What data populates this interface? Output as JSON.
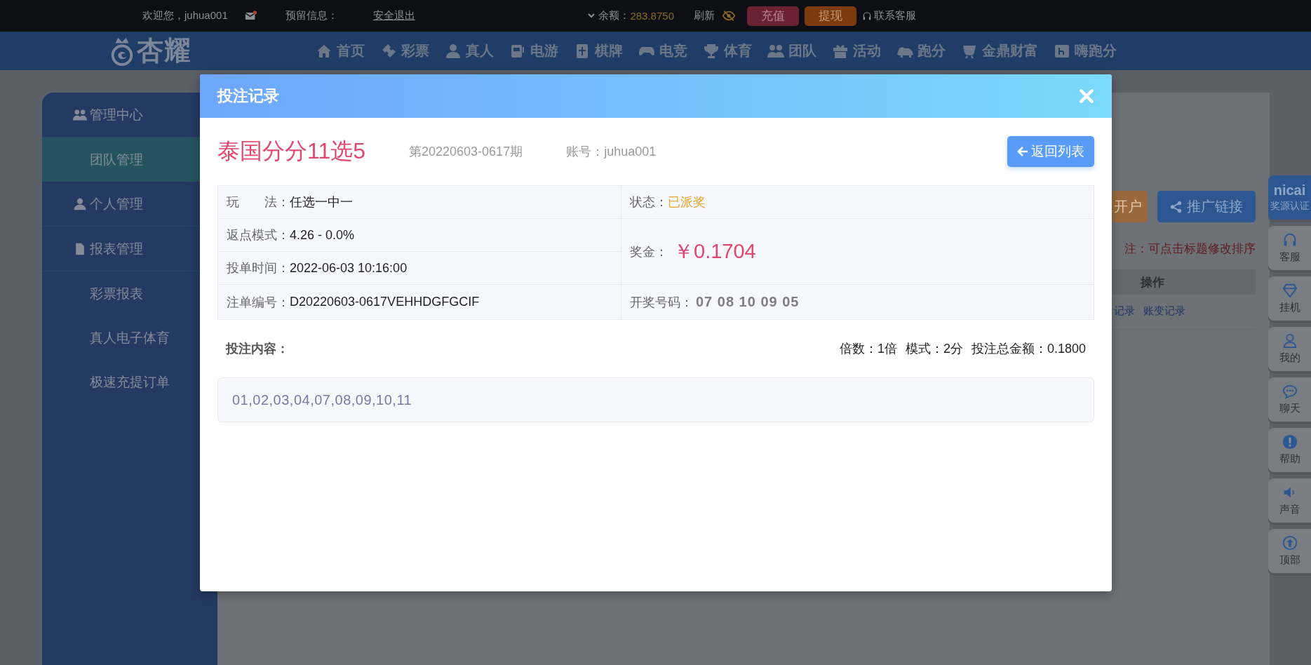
{
  "top_bar": {
    "welcome": "欢迎您，juhua001",
    "reserved_label": "预留信息：",
    "logout": "安全退出",
    "balance_label": "余额：",
    "balance": "283.8750",
    "refresh": "刷新",
    "deposit": "充值",
    "withdraw": "提现",
    "support": "联系客服"
  },
  "nav": {
    "logo": "杏耀",
    "items": [
      {
        "label": "首页",
        "kind": "home"
      },
      {
        "label": "彩票",
        "kind": "ticket"
      },
      {
        "label": "真人",
        "kind": "person"
      },
      {
        "label": "电游",
        "kind": "slot"
      },
      {
        "label": "棋牌",
        "kind": "card"
      },
      {
        "label": "电竞",
        "kind": "gamepad"
      },
      {
        "label": "体育",
        "kind": "trophy"
      },
      {
        "label": "团队",
        "kind": "team"
      },
      {
        "label": "活动",
        "kind": "gift"
      },
      {
        "label": "跑分",
        "kind": "rhino"
      },
      {
        "label": "金鼎财富",
        "kind": "cup"
      },
      {
        "label": "嗨跑分",
        "kind": "h"
      }
    ]
  },
  "sidebar": {
    "groups": [
      {
        "label": "管理中心",
        "kind": "team",
        "children": [
          {
            "label": "团队管理",
            "selected": true
          }
        ]
      },
      {
        "label": "个人管理",
        "kind": "person"
      },
      {
        "label": "报表管理",
        "kind": "doc",
        "children": [
          {
            "label": "彩票报表",
            "selected": false
          },
          {
            "label": "真人电子体育",
            "selected": false
          },
          {
            "label": "极速充提订单",
            "selected": false
          }
        ]
      }
    ]
  },
  "content": {
    "buttons": [
      {
        "label": "开户",
        "kind": "orange"
      },
      {
        "label": "推广链接",
        "kind": "share"
      }
    ],
    "note": "注：可点击标题修改排序",
    "table_header": "操作",
    "links": [
      "记录",
      "账变记录"
    ]
  },
  "side_tabs": [
    {
      "label": "奖源认证",
      "kind": "brand",
      "brand": "nicai"
    },
    {
      "label": "客服",
      "kind": "headset"
    },
    {
      "label": "挂机",
      "kind": "diamond"
    },
    {
      "label": "我的",
      "kind": "user"
    },
    {
      "label": "聊天",
      "kind": "chat"
    },
    {
      "label": "帮助",
      "kind": "help"
    },
    {
      "label": "声音",
      "kind": "sound"
    },
    {
      "label": "顶部",
      "kind": "top"
    }
  ],
  "modal": {
    "title": "投注记录",
    "lottery": "泰国分分11选5",
    "issue": "第20220603-0617期",
    "account": "账号：juhua001",
    "back_button": "返回列表",
    "details": {
      "play": {
        "label": "玩　　法：",
        "value": "任选一中一"
      },
      "status": {
        "label": "状态：",
        "value": "已派奖"
      },
      "rebate": {
        "label": "返点模式：",
        "value": "4.26 - 0.0%"
      },
      "prize": {
        "label": "奖金：",
        "value": "￥0.1704"
      },
      "time": {
        "label": "投单时间：",
        "value": "2022-06-03 10:16:00"
      },
      "order_no": {
        "label": "注单编号：",
        "value": "D20220603-0617VEHHDGFGCIF"
      },
      "draw": {
        "label": "开奖号码：",
        "value": "07 08 10 09 05"
      }
    },
    "bet_content": {
      "label": "投注内容：",
      "summary": [
        "倍数：1倍",
        "模式：2分",
        "投注总金额：0.1800"
      ],
      "numbers": "01,02,03,04,07,08,09,10,11"
    }
  }
}
